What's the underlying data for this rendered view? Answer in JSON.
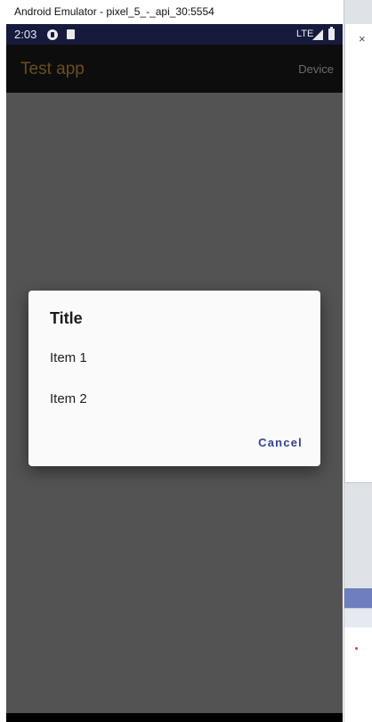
{
  "window": {
    "title": "Android Emulator - pixel_5_-_api_30:5554"
  },
  "status_bar": {
    "time": "2:03",
    "network": "LTE",
    "icons": [
      "notification-icon",
      "sd-card-icon",
      "signal-icon",
      "battery-icon"
    ]
  },
  "app_bar": {
    "title": "Test app",
    "action_label": "Device"
  },
  "dialog": {
    "title": "Title",
    "items": [
      "Item 1",
      "Item 2"
    ],
    "cancel_label": "Cancel"
  },
  "side_toolbar": {
    "close_glyph": "×",
    "icons": [
      "power-icon",
      "volume-up-icon",
      "volume-down-icon",
      "rotate-left-icon",
      "rotate-right-icon",
      "camera-icon",
      "zoom-icon",
      "back-icon",
      "home-icon",
      "overview-icon",
      "more-icon"
    ]
  },
  "colors": {
    "status_bar": "#161a3d",
    "app_bar": "#0d0d0d",
    "app_title": "#6a4f1d",
    "scrim": "#535353",
    "dialog_bg": "#fafafa",
    "cancel_text": "#34418e"
  }
}
